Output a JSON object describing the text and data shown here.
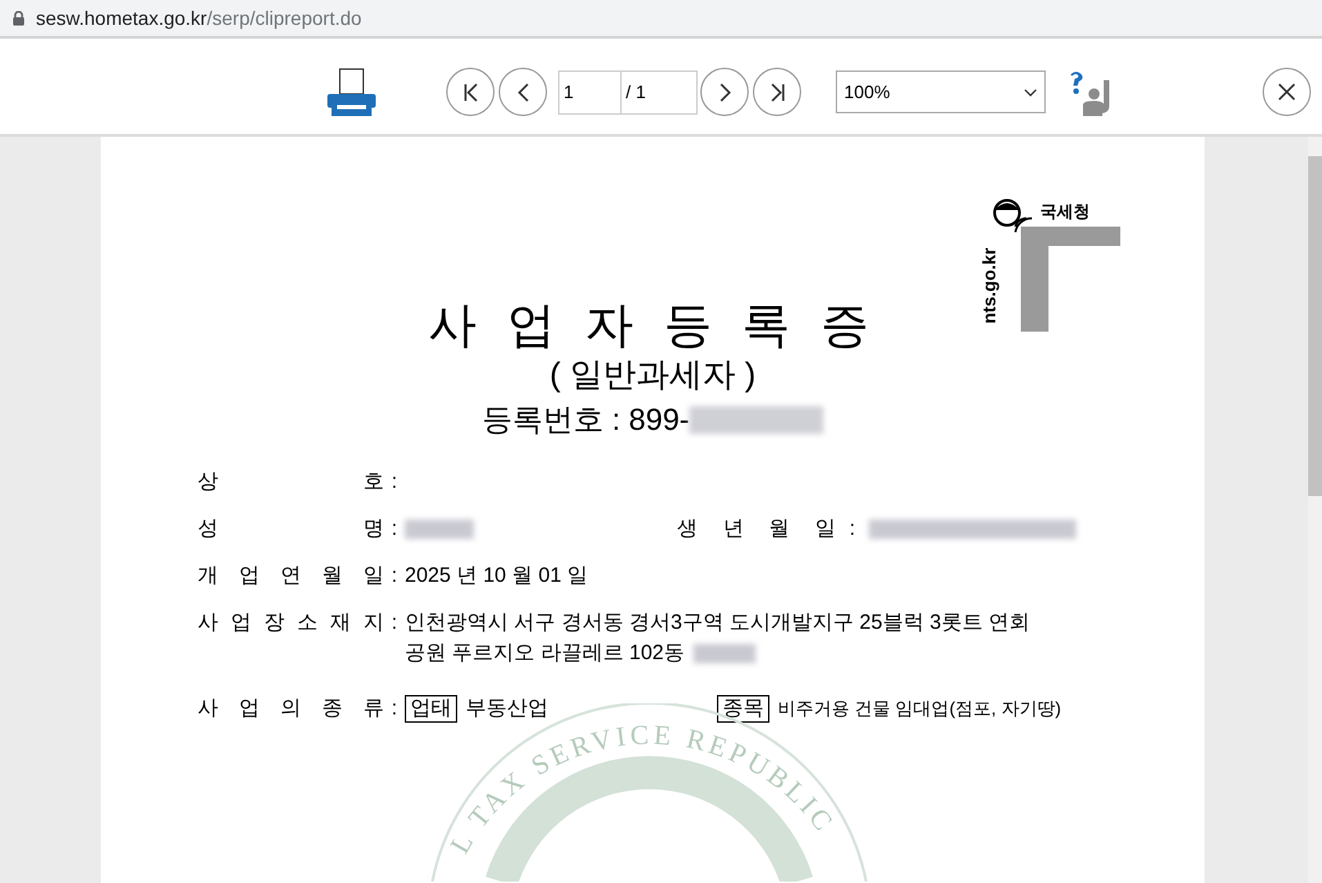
{
  "address_bar": {
    "url_host": "sesw.hometax.go.kr",
    "url_path": "/serp/clipreport.do"
  },
  "toolbar": {
    "page_input": "1",
    "page_total": "/ 1",
    "zoom": "100%"
  },
  "document": {
    "logo": {
      "agency": "국세청",
      "domain": "nts.go.kr"
    },
    "title": "사 업 자 등 록 증",
    "subtitle": "( 일반과세자 )",
    "reg_label": "등록번호 :",
    "reg_number": "899-",
    "fields": [
      {
        "kind": "plain",
        "label": "상 호",
        "colon": ":"
      },
      {
        "kind": "person",
        "label": "성 명",
        "colon": ":",
        "redacted": true,
        "extra": {
          "label": "생 년 월 일",
          "colon": ":",
          "redacted": true
        }
      },
      {
        "kind": "plain",
        "label": "개 업 연 월 일",
        "colon": ":",
        "value": "2025 년 10 월 01 일"
      },
      {
        "kind": "address",
        "label": "사 업 장 소 재 지",
        "colon": ":",
        "lines": [
          "인천광역시 서구 경서동 경서3구역 도시개발지구 25블럭 3롯트 연회",
          "공원 푸르지오 라끌레르 102동"
        ],
        "redacted": true
      },
      {
        "kind": "types",
        "label": "사 업 의 종 류",
        "colon": ":",
        "types": [
          {
            "tag": "업태",
            "value": "부동산업"
          },
          {
            "tag": "종목",
            "value": "비주거용 건물 임대업(점포, 자기땅)"
          }
        ]
      }
    ],
    "watermark": {
      "text": "L TAX SERVICE REPUBLIC"
    }
  }
}
